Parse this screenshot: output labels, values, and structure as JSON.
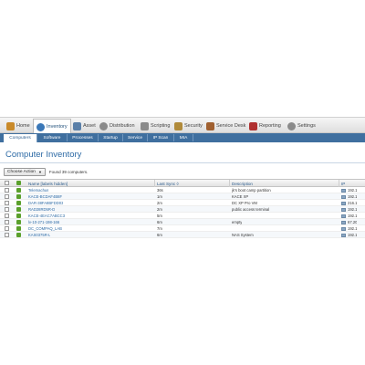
{
  "main_nav": {
    "items": [
      {
        "label": "Home",
        "icon": "home-icon",
        "color": "#c98a2a"
      },
      {
        "label": "Inventory",
        "icon": "inventory-icon",
        "color": "#3b78b8"
      },
      {
        "label": "Asset",
        "icon": "asset-icon",
        "color": "#5a7fa8"
      },
      {
        "label": "Distribution",
        "icon": "distribution-icon",
        "color": "#8a8a8a"
      },
      {
        "label": "Scripting",
        "icon": "scripting-icon",
        "color": "#8a8a8a"
      },
      {
        "label": "Security",
        "icon": "security-icon",
        "color": "#b08a3a"
      },
      {
        "label": "Service Desk",
        "icon": "service-desk-icon",
        "color": "#a06030"
      },
      {
        "label": "Reporting",
        "icon": "reporting-icon",
        "color": "#b03030"
      },
      {
        "label": "Settings",
        "icon": "settings-icon",
        "color": "#8a8a8a"
      }
    ]
  },
  "sub_nav": {
    "tabs": [
      {
        "label": "Computers"
      },
      {
        "label": "Software"
      },
      {
        "label": "Processes"
      },
      {
        "label": "Startup"
      },
      {
        "label": "Service"
      },
      {
        "label": "IP Scan"
      },
      {
        "label": "MIA"
      }
    ]
  },
  "page": {
    "title": "Computer Inventory",
    "choose_action": "Choose Action",
    "found_text": "Found 39 computers."
  },
  "table": {
    "columns": [
      "Name [labels hidden]",
      "Last Sync ◊",
      "Description",
      "IP"
    ],
    "rows": [
      {
        "name": "Telemachus",
        "sync": "36s",
        "desc": "jk's boot camp partition",
        "ip": "192.1"
      },
      {
        "name": "KACE-BCDAF4B8F",
        "sync": "1m",
        "desc": "KACE XP",
        "ip": "192.1"
      },
      {
        "name": "DAR-38FA8BFDD03",
        "sync": "2m",
        "desc": "DC XP Pro VM",
        "ip": "216.1"
      },
      {
        "name": "RAD28RD5R-D",
        "sync": "2m",
        "desc": "public access terminal",
        "ip": "192.1"
      },
      {
        "name": "KACE-4EAC7ABCC3",
        "sync": "5m",
        "desc": "",
        "ip": "192.1"
      },
      {
        "name": "lv-10-271-198-166",
        "sync": "6m",
        "desc": "empty",
        "ip": "67.20"
      },
      {
        "name": "DC_COMPAQ_LAB",
        "sync": "7m",
        "desc": "",
        "ip": "192.1"
      },
      {
        "name": "KAS0375R-L",
        "sync": "6m",
        "desc": "NAS System",
        "ip": "192.1"
      }
    ]
  }
}
